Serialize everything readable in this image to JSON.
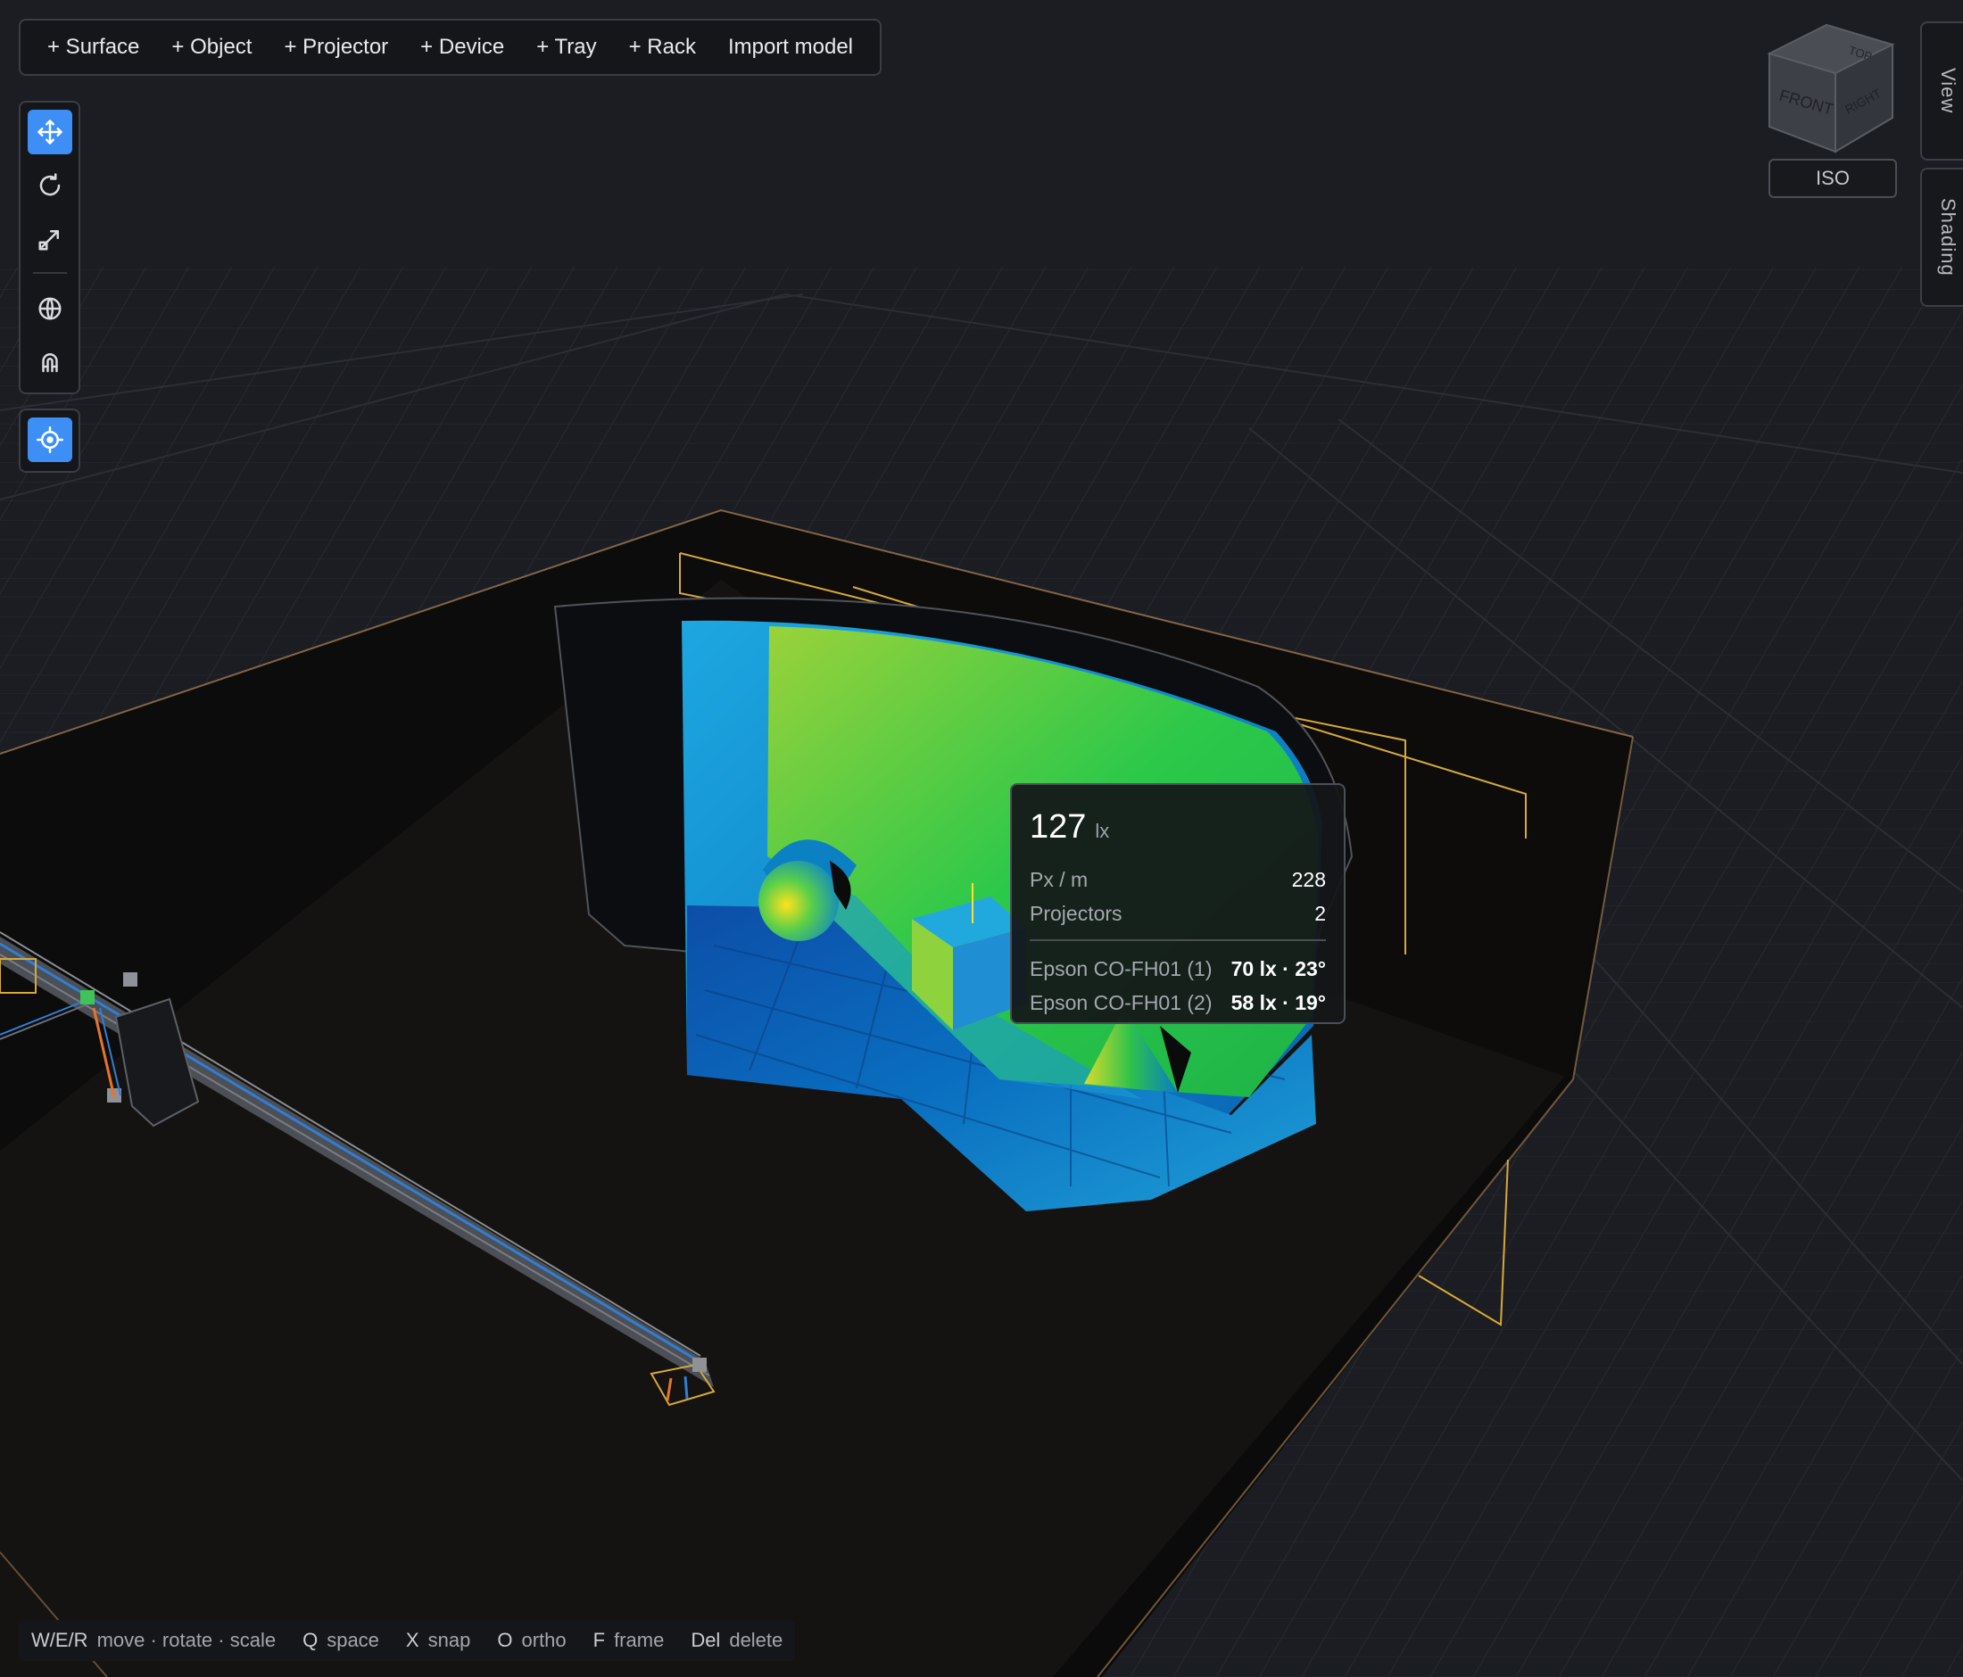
{
  "toolbar": {
    "items": [
      {
        "label": "+ Surface"
      },
      {
        "label": "+ Object"
      },
      {
        "label": "+ Projector"
      },
      {
        "label": "+ Device"
      },
      {
        "label": "+ Tray"
      },
      {
        "label": "+ Rack"
      },
      {
        "label": "Import model"
      }
    ]
  },
  "tools": [
    {
      "icon": "move-icon",
      "active": true
    },
    {
      "icon": "rotate-icon",
      "active": false
    },
    {
      "icon": "scale-icon",
      "active": false
    },
    {
      "icon": "globe-icon",
      "active": false
    },
    {
      "icon": "magnet-icon",
      "active": false
    },
    {
      "icon": "target-icon",
      "active": true
    }
  ],
  "view_cube": {
    "faces": {
      "top": "TOP",
      "front": "FRONT",
      "right": "RIGHT"
    },
    "preset_label": "ISO"
  },
  "side_tabs": {
    "view": "View",
    "shading": "Shading"
  },
  "tooltip": {
    "value": "127",
    "unit": "lx",
    "rows": [
      {
        "key": "Px / m",
        "value": "228"
      },
      {
        "key": "Projectors",
        "value": "2"
      }
    ],
    "projectors": [
      {
        "name": "Epson CO-FH01 (1)",
        "value": "70 lx · 23°"
      },
      {
        "name": "Epson CO-FH01 (2)",
        "value": "58 lx · 19°"
      }
    ]
  },
  "statusbar": {
    "items": [
      {
        "key": "W/E/R",
        "label": "move · rotate · scale"
      },
      {
        "key": "Q",
        "label": "space"
      },
      {
        "key": "X",
        "label": "snap"
      },
      {
        "key": "O",
        "label": "ortho"
      },
      {
        "key": "F",
        "label": "frame"
      },
      {
        "key": "Del",
        "label": "delete"
      }
    ]
  },
  "colors": {
    "background": "#1b1d22",
    "accent": "#3d8ff5",
    "selection_outline": "#e2b84a",
    "heatmap_low": "#1f63b8",
    "heatmap_mid": "#1fc44a",
    "heatmap_high": "#ffd21a"
  }
}
